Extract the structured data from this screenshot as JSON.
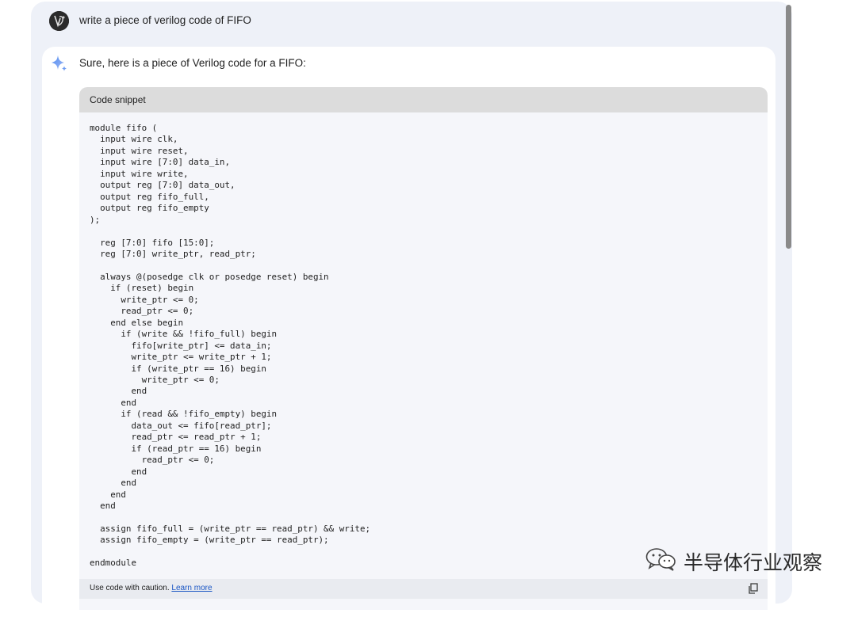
{
  "prompt": {
    "text": "write a piece of verilog code of FIFO"
  },
  "response": {
    "intro": "Sure, here is a piece of Verilog code for a FIFO:",
    "code_block": {
      "header": "Code snippet",
      "code": "module fifo (\n  input wire clk,\n  input wire reset,\n  input wire [7:0] data_in,\n  input wire write,\n  output reg [7:0] data_out,\n  output reg fifo_full,\n  output reg fifo_empty\n);\n\n  reg [7:0] fifo [15:0];\n  reg [7:0] write_ptr, read_ptr;\n\n  always @(posedge clk or posedge reset) begin\n    if (reset) begin\n      write_ptr <= 0;\n      read_ptr <= 0;\n    end else begin\n      if (write && !fifo_full) begin\n        fifo[write_ptr] <= data_in;\n        write_ptr <= write_ptr + 1;\n        if (write_ptr == 16) begin\n          write_ptr <= 0;\n        end\n      end\n      if (read && !fifo_empty) begin\n        data_out <= fifo[read_ptr];\n        read_ptr <= read_ptr + 1;\n        if (read_ptr == 16) begin\n          read_ptr <= 0;\n        end\n      end\n    end\n  end\n\n  assign fifo_full = (write_ptr == read_ptr) && write;\n  assign fifo_empty = (write_ptr == read_ptr);\n\nendmodule",
      "footer_text": "Use code with caution. ",
      "footer_link": "Learn more"
    }
  },
  "watermark": {
    "text": "半导体行业观察"
  },
  "icons": {
    "avatar": "user-avatar",
    "assistant": "gemini-sparkle-icon",
    "copy": "copy-icon",
    "watermark_logo": "wechat-icon"
  },
  "colors": {
    "panel_bg": "#eef1f8",
    "card_bg": "#ffffff",
    "code_bg": "#f5f6fa",
    "code_header_bg": "#dcdcdc",
    "link": "#1a56c4",
    "sparkle_start": "#4f8cf0",
    "sparkle_end": "#9fb7f5"
  }
}
